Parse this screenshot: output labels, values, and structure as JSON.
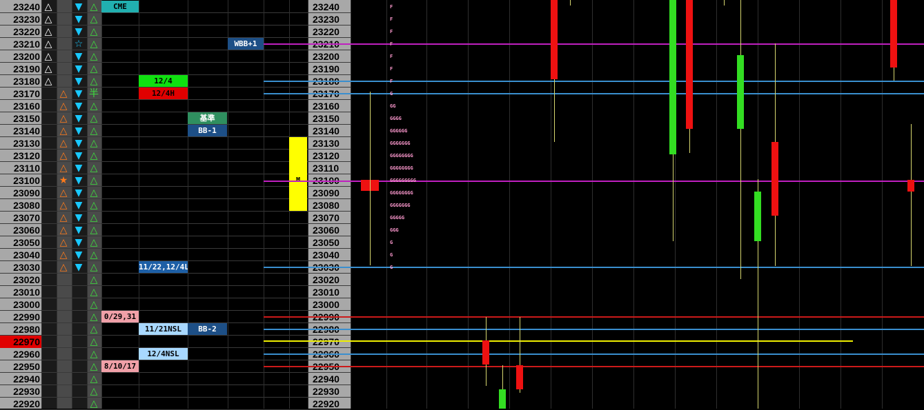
{
  "prices": [
    "23240",
    "23230",
    "23220",
    "23210",
    "23200",
    "23190",
    "23180",
    "23170",
    "23160",
    "23150",
    "23140",
    "23130",
    "23120",
    "23110",
    "23100",
    "23090",
    "23080",
    "23070",
    "23060",
    "23050",
    "23040",
    "23030",
    "23020",
    "23010",
    "23000",
    "22990",
    "22980",
    "22970",
    "22960",
    "22950",
    "22940",
    "22930",
    "22920"
  ],
  "current_price": "22970",
  "symbols": [
    [
      "△",
      "",
      "▼",
      "△"
    ],
    [
      "△",
      "",
      "▼",
      "△"
    ],
    [
      "△",
      "",
      "▼",
      "△"
    ],
    [
      "△",
      "",
      "☆",
      "△"
    ],
    [
      "△",
      "",
      "▼",
      "△"
    ],
    [
      "△",
      "",
      "▼",
      "△"
    ],
    [
      "△",
      "",
      "▼",
      "△"
    ],
    [
      "",
      "△",
      "▼",
      "半"
    ],
    [
      "",
      "△",
      "▼",
      "△"
    ],
    [
      "",
      "△",
      "▼",
      "△"
    ],
    [
      "",
      "△",
      "▼",
      "△"
    ],
    [
      "",
      "△",
      "▼",
      "△"
    ],
    [
      "",
      "△",
      "▼",
      "△"
    ],
    [
      "",
      "△",
      "▼",
      "△"
    ],
    [
      "",
      "★",
      "▼",
      "△"
    ],
    [
      "",
      "△",
      "▼",
      "△"
    ],
    [
      "",
      "△",
      "▼",
      "△"
    ],
    [
      "",
      "△",
      "▼",
      "△"
    ],
    [
      "",
      "△",
      "▼",
      "△"
    ],
    [
      "",
      "△",
      "▼",
      "△"
    ],
    [
      "",
      "△",
      "▼",
      "△"
    ],
    [
      "",
      "△",
      "▼",
      "△"
    ],
    [
      "",
      "",
      "",
      "△"
    ],
    [
      "",
      "",
      "",
      "△"
    ],
    [
      "",
      "",
      "",
      "△"
    ],
    [
      "",
      "",
      "",
      "△"
    ],
    [
      "",
      "",
      "",
      "△"
    ],
    [
      "",
      "",
      "",
      "△"
    ],
    [
      "",
      "",
      "",
      "△"
    ],
    [
      "",
      "",
      "",
      "△"
    ],
    [
      "",
      "",
      "",
      "△"
    ],
    [
      "",
      "",
      "",
      "△"
    ],
    [
      "",
      "",
      "",
      "△"
    ]
  ],
  "tags": {
    "cme": "CME",
    "d124": "12/4",
    "d124h": "12/4H",
    "kijun": "基準",
    "bb1": "BB-1",
    "wbb1": "WBB+1",
    "d1122": "11/22,12/4L",
    "d0929": "0/29,31",
    "d1121": "11/21NSL",
    "bb2": "BB-2",
    "d124nsl": "12/4NSL",
    "d0810": "8/10/17",
    "m": "M"
  },
  "tpo": [
    "F",
    "F",
    "F",
    "F",
    "F",
    "F",
    "F",
    "G",
    "GG",
    "GGGG",
    "GGGGGG",
    "GGGGGGG",
    "GGGGGGGG",
    "GGGGGGGG",
    "GGGGGGGGG",
    "GGGGGGGG",
    "GGGGGGG",
    "GGGGG",
    "GGG",
    "G",
    "G",
    "G"
  ],
  "colors": {
    "bull": "#33dd22",
    "bear": "#ee1111",
    "magenta": "#c020c0",
    "blue": "#3a8fcf",
    "red_line": "#cc1a1a",
    "yellow": "#f0f000"
  }
}
